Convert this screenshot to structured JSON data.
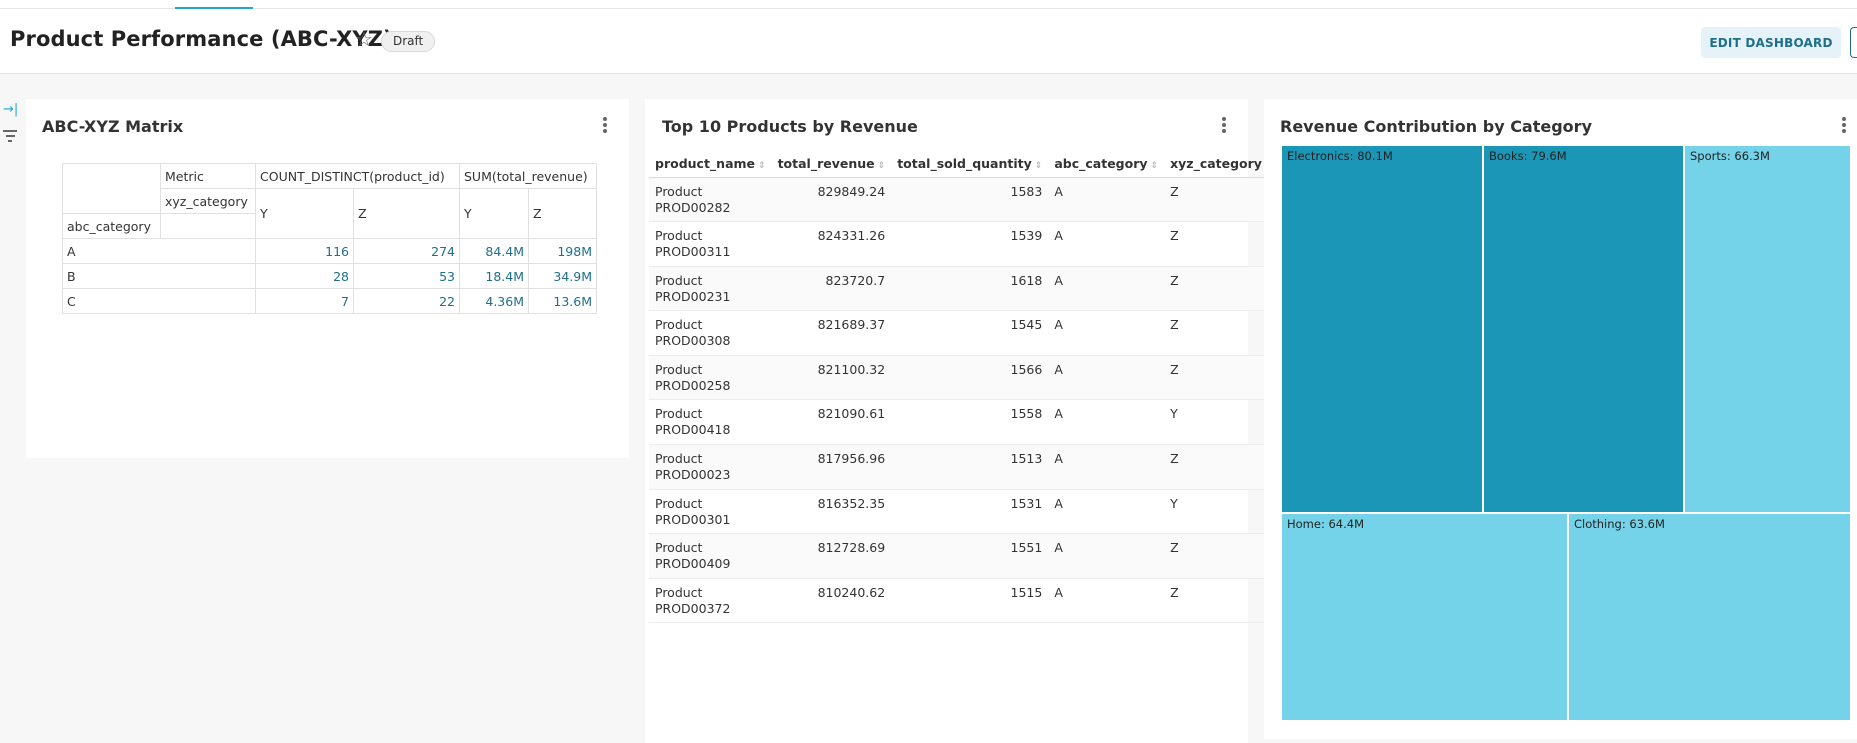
{
  "header": {
    "title": "Product Performance (ABC-XYZ)",
    "status_badge": "Draft",
    "edit_button": "EDIT DASHBOARD",
    "star_icon": "star-outline-icon"
  },
  "left_rail": {
    "expand_icon": "expand-right-icon",
    "filter_icon": "filter-icon"
  },
  "colors": {
    "accent": "#20a7c9",
    "link_number": "#1f6f8c",
    "treemap_dark": "#1c96b6",
    "treemap_light": "#74d3e8"
  },
  "abc_matrix": {
    "title": "ABC-XYZ Matrix",
    "metric_label": "Metric",
    "metric_count": "COUNT_DISTINCT(product_id)",
    "metric_sum": "SUM(total_revenue)",
    "column_dim": "xyz_category",
    "row_dim": "abc_category",
    "sub_columns": [
      "Y",
      "Z",
      "Y",
      "Z"
    ],
    "rows": [
      {
        "label": "A",
        "values": [
          "116",
          "274",
          "84.4M",
          "198M"
        ]
      },
      {
        "label": "B",
        "values": [
          "28",
          "53",
          "18.4M",
          "34.9M"
        ]
      },
      {
        "label": "C",
        "values": [
          "7",
          "22",
          "4.36M",
          "13.6M"
        ]
      }
    ]
  },
  "top10": {
    "title": "Top 10 Products by Revenue",
    "columns": [
      "product_name",
      "total_revenue",
      "total_sold_quantity",
      "abc_category",
      "xyz_category"
    ],
    "rows": [
      {
        "name_l1": "Product",
        "name_l2": "PROD00282",
        "revenue": "829849.24",
        "qty": "1583",
        "abc": "A",
        "xyz": "Z"
      },
      {
        "name_l1": "Product",
        "name_l2": "PROD00311",
        "revenue": "824331.26",
        "qty": "1539",
        "abc": "A",
        "xyz": "Z"
      },
      {
        "name_l1": "Product",
        "name_l2": "PROD00231",
        "revenue": "823720.7",
        "qty": "1618",
        "abc": "A",
        "xyz": "Z"
      },
      {
        "name_l1": "Product",
        "name_l2": "PROD00308",
        "revenue": "821689.37",
        "qty": "1545",
        "abc": "A",
        "xyz": "Z"
      },
      {
        "name_l1": "Product",
        "name_l2": "PROD00258",
        "revenue": "821100.32",
        "qty": "1566",
        "abc": "A",
        "xyz": "Z"
      },
      {
        "name_l1": "Product",
        "name_l2": "PROD00418",
        "revenue": "821090.61",
        "qty": "1558",
        "abc": "A",
        "xyz": "Y"
      },
      {
        "name_l1": "Product",
        "name_l2": "PROD00023",
        "revenue": "817956.96",
        "qty": "1513",
        "abc": "A",
        "xyz": "Z"
      },
      {
        "name_l1": "Product",
        "name_l2": "PROD00301",
        "revenue": "816352.35",
        "qty": "1531",
        "abc": "A",
        "xyz": "Y"
      },
      {
        "name_l1": "Product",
        "name_l2": "PROD00409",
        "revenue": "812728.69",
        "qty": "1551",
        "abc": "A",
        "xyz": "Z"
      },
      {
        "name_l1": "Product",
        "name_l2": "PROD00372",
        "revenue": "810240.62",
        "qty": "1515",
        "abc": "A",
        "xyz": "Z"
      }
    ]
  },
  "chart_data": {
    "type": "treemap",
    "title": "Revenue Contribution by Category",
    "unit": "M",
    "items": [
      {
        "name": "Electronics",
        "value": 80.1,
        "label": "Electronics: 80.1M"
      },
      {
        "name": "Books",
        "value": 79.6,
        "label": "Books: 79.6M"
      },
      {
        "name": "Sports",
        "value": 66.3,
        "label": "Sports: 66.3M"
      },
      {
        "name": "Home",
        "value": 64.4,
        "label": "Home: 64.4M"
      },
      {
        "name": "Clothing",
        "value": 63.6,
        "label": "Clothing: 63.6M"
      }
    ]
  }
}
